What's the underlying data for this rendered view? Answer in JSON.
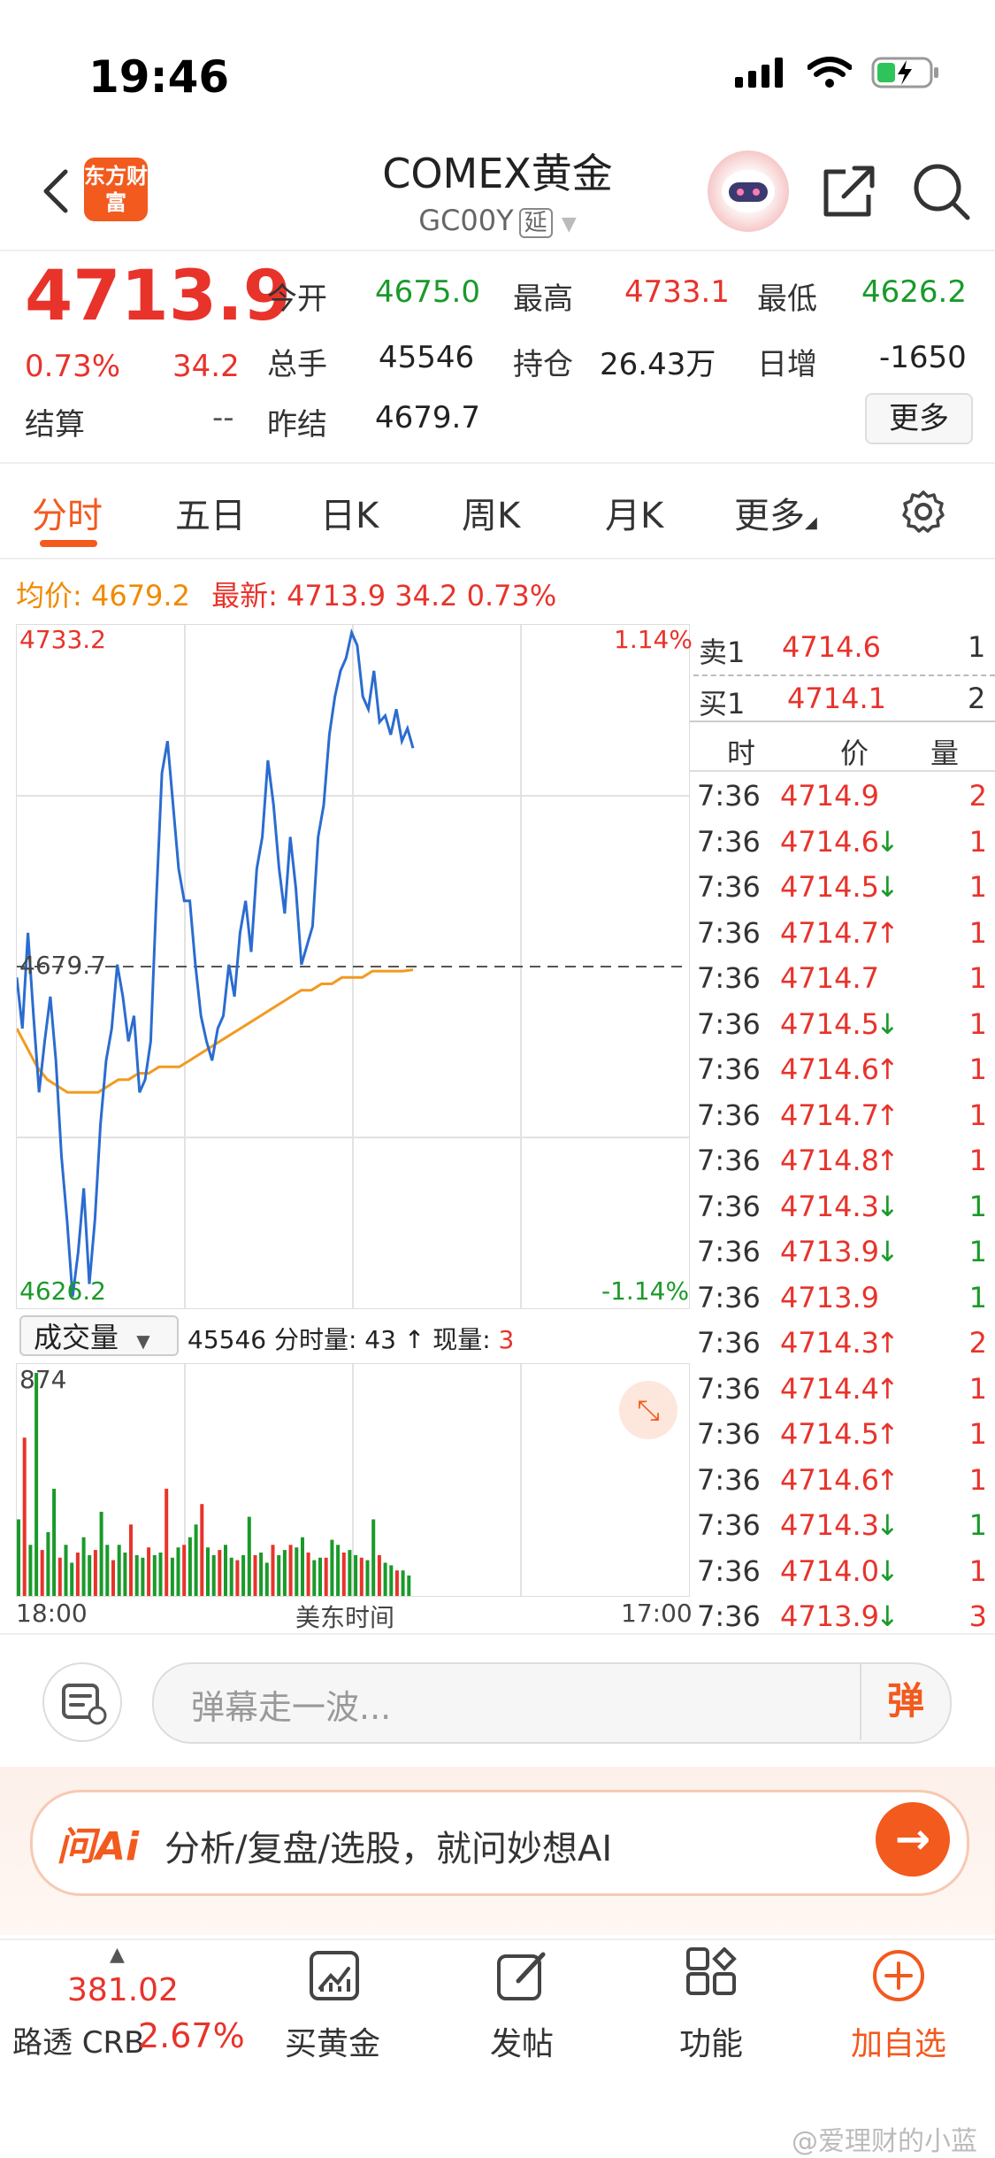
{
  "status_bar": {
    "time": "19:46"
  },
  "header": {
    "logo_text": "东方财富",
    "title": "COMEX黄金",
    "code": "GC00Y",
    "delay_tag": "延"
  },
  "quote": {
    "last": "4713.9",
    "change_pct": "0.73%",
    "change": "34.2",
    "open_label": "今开",
    "open": "4675.0",
    "high_label": "最高",
    "high": "4733.1",
    "low_label": "最低",
    "low": "4626.2",
    "volume_label": "总手",
    "volume": "45546",
    "oi_label": "持仓",
    "oi": "26.43万",
    "daily_inc_label": "日增",
    "daily_inc": "-1650",
    "settle_label": "结算",
    "settle": "--",
    "prev_settle_label": "昨结",
    "prev_settle": "4679.7",
    "more_label": "更多"
  },
  "tabs": [
    "分时",
    "五日",
    "日K",
    "周K",
    "月K",
    "更多"
  ],
  "info_line": {
    "avg_label": "均价:",
    "avg": "4679.2",
    "latest_label": "最新:",
    "latest": "4713.9",
    "chg": "34.2",
    "pct": "0.73%"
  },
  "chart_data": {
    "type": "line",
    "y_max_label": "4733.2",
    "y_min_label": "4626.2",
    "y_mid_label": "4679.7",
    "pct_max_label": "1.14%",
    "pct_min_label": "-1.14%",
    "ylim": [
      4626.2,
      4733.2
    ],
    "reference": 4679.7,
    "x_start_label": "18:00",
    "x_mid_label": "美东时间",
    "x_end_label": "17:00",
    "series": [
      {
        "name": "",
        "values": [
          4678,
          4670,
          4685,
          4672,
          4660,
          4668,
          4675,
          4665,
          4650,
          4640,
          4628,
          4635,
          4645,
          4630,
          4640,
          4655,
          4665,
          4670,
          4680,
          4675,
          4668,
          4672,
          4660,
          4662,
          4668,
          4690,
          4710,
          4715,
          4705,
          4695,
          4690,
          4690,
          4680,
          4672,
          4668,
          4665,
          4670,
          4672,
          4680,
          4675,
          4685,
          4690,
          4682,
          4695,
          4700,
          4712,
          4705,
          4695,
          4688,
          4700,
          4692,
          4680,
          4683,
          4686,
          4700,
          4705,
          4716,
          4722,
          4726,
          4728,
          4732,
          4730,
          4722,
          4720,
          4726,
          4718,
          4719,
          4716,
          4720,
          4715,
          4717,
          4713.9
        ]
      },
      {
        "name": "均价",
        "values": [
          4670,
          4667,
          4664,
          4662,
          4661,
          4660,
          4660,
          4660,
          4660,
          4661,
          4662,
          4662,
          4663,
          4663,
          4664,
          4664,
          4664,
          4665,
          4666,
          4667,
          4668,
          4669,
          4670,
          4671,
          4672,
          4673,
          4674,
          4675,
          4676,
          4676,
          4677,
          4677,
          4678,
          4678,
          4678,
          4679,
          4679,
          4679,
          4679,
          4679.2
        ]
      }
    ],
    "volume": {
      "max_label": "874",
      "total": "45546",
      "values": [
        300,
        620,
        200,
        874,
        180,
        250,
        420,
        150,
        200,
        130,
        170,
        230,
        160,
        180,
        330,
        200,
        140,
        200,
        170,
        280,
        160,
        150,
        190,
        160,
        170,
        420,
        150,
        190,
        200,
        230,
        280,
        360,
        190,
        160,
        180,
        200,
        150,
        140,
        160,
        310,
        160,
        170,
        130,
        200,
        160,
        180,
        200,
        190,
        230,
        170,
        140,
        150,
        150,
        220,
        200,
        170,
        180,
        160,
        150,
        140,
        300,
        160,
        130,
        120,
        100,
        100,
        80
      ]
    }
  },
  "order_book": {
    "sell_label": "卖1",
    "sell_price": "4714.6",
    "sell_qty": "1",
    "buy_label": "买1",
    "buy_price": "4714.1",
    "buy_qty": "2",
    "col_time": "时",
    "col_price": "价",
    "col_qty": "量",
    "ticks": [
      {
        "time": "7:36",
        "price": "4714.9",
        "arrow": "",
        "qty": "2",
        "color": "red"
      },
      {
        "time": "7:36",
        "price": "4714.6",
        "arrow": "↓",
        "qty": "1",
        "color": "red"
      },
      {
        "time": "7:36",
        "price": "4714.5",
        "arrow": "↓",
        "qty": "1",
        "color": "red"
      },
      {
        "time": "7:36",
        "price": "4714.7",
        "arrow": "↑",
        "qty": "1",
        "color": "red"
      },
      {
        "time": "7:36",
        "price": "4714.7",
        "arrow": "",
        "qty": "1",
        "color": "red"
      },
      {
        "time": "7:36",
        "price": "4714.5",
        "arrow": "↓",
        "qty": "1",
        "color": "red"
      },
      {
        "time": "7:36",
        "price": "4714.6",
        "arrow": "↑",
        "qty": "1",
        "color": "red"
      },
      {
        "time": "7:36",
        "price": "4714.7",
        "arrow": "↑",
        "qty": "1",
        "color": "red"
      },
      {
        "time": "7:36",
        "price": "4714.8",
        "arrow": "↑",
        "qty": "1",
        "color": "red"
      },
      {
        "time": "7:36",
        "price": "4714.3",
        "arrow": "↓",
        "qty": "1",
        "color": "green"
      },
      {
        "time": "7:36",
        "price": "4713.9",
        "arrow": "↓",
        "qty": "1",
        "color": "green"
      },
      {
        "time": "7:36",
        "price": "4713.9",
        "arrow": "",
        "qty": "1",
        "color": "green"
      },
      {
        "time": "7:36",
        "price": "4714.3",
        "arrow": "↑",
        "qty": "2",
        "color": "red"
      },
      {
        "time": "7:36",
        "price": "4714.4",
        "arrow": "↑",
        "qty": "1",
        "color": "red"
      },
      {
        "time": "7:36",
        "price": "4714.5",
        "arrow": "↑",
        "qty": "1",
        "color": "red"
      },
      {
        "time": "7:36",
        "price": "4714.6",
        "arrow": "↑",
        "qty": "1",
        "color": "red"
      },
      {
        "time": "7:36",
        "price": "4714.3",
        "arrow": "↓",
        "qty": "1",
        "color": "green"
      },
      {
        "time": "7:36",
        "price": "4714.0",
        "arrow": "↓",
        "qty": "1",
        "color": "red"
      },
      {
        "time": "7:36",
        "price": "4713.9",
        "arrow": "↓",
        "qty": "3",
        "color": "red"
      }
    ]
  },
  "volume_controls": {
    "select_label": "成交量",
    "info": "45546 分时量: 43 ↑ 现量: ",
    "current_qty": "3"
  },
  "bullet": {
    "placeholder": "弹幕走一波...",
    "send_label": "弹"
  },
  "ai_banner": {
    "logo": "问Ai",
    "text": "分析/复盘/选股，就问妙想AI"
  },
  "bottom_nav": {
    "crb_value": "381.02",
    "crb_name": "路透 CRB",
    "crb_change": "2.67%",
    "items": [
      "买黄金",
      "发帖",
      "功能",
      "加自选"
    ]
  },
  "watermark": "@爱理财的小蓝",
  "colors": {
    "up": "#e8332b",
    "down": "#1a9a2a",
    "brand": "#f25a1e",
    "avg_line": "#f29a1f",
    "price_line": "#2b6cd0"
  }
}
